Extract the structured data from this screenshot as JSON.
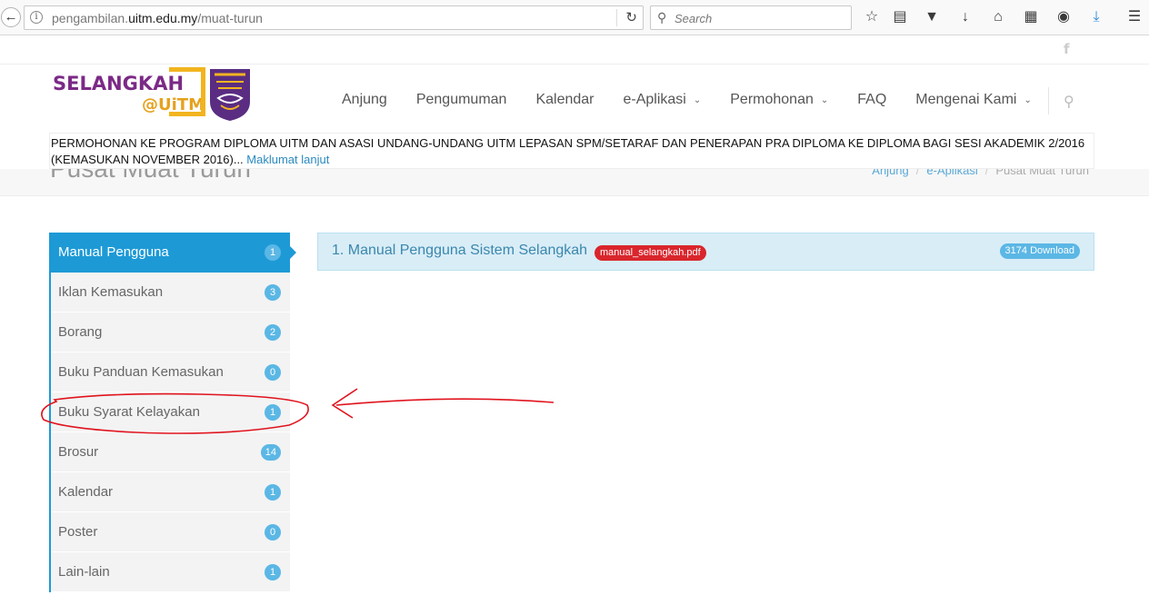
{
  "browser": {
    "url_prefix": "pengambilan.",
    "url_domain": "uitm.edu.my",
    "url_path": "/muat-turun",
    "search_placeholder": "Search"
  },
  "header": {
    "logo_text": "SELANGKAH",
    "logo_suffix": "@UiTM",
    "nav": [
      {
        "label": "Anjung",
        "dropdown": false
      },
      {
        "label": "Pengumuman",
        "dropdown": false
      },
      {
        "label": "Kalendar",
        "dropdown": false
      },
      {
        "label": "e-Aplikasi",
        "dropdown": true
      },
      {
        "label": "Permohonan",
        "dropdown": true
      },
      {
        "label": "FAQ",
        "dropdown": false
      },
      {
        "label": "Mengenai Kami",
        "dropdown": true
      }
    ]
  },
  "announcement": {
    "text": "PERMOHONAN KE PROGRAM DIPLOMA UITM DAN ASASI UNDANG-UNDANG UITM LEPASAN SPM/SETARAF DAN PENERAPAN PRA DIPLOMA KE DIPLOMA BAGI SESI AKADEMIK 2/2016 (KEMASUKAN NOVEMBER 2016)...",
    "link": "Maklumat lanjut"
  },
  "page": {
    "title": "Pusat Muat Turun",
    "breadcrumb": [
      "Anjung",
      "e-Aplikasi",
      "Pusat Muat Turun"
    ]
  },
  "sidebar": {
    "items": [
      {
        "label": "Manual Pengguna",
        "count": "1",
        "active": true
      },
      {
        "label": "Iklan Kemasukan",
        "count": "3",
        "active": false
      },
      {
        "label": "Borang",
        "count": "2",
        "active": false
      },
      {
        "label": "Buku Panduan Kemasukan",
        "count": "0",
        "active": false
      },
      {
        "label": "Buku Syarat Kelayakan",
        "count": "1",
        "active": false
      },
      {
        "label": "Brosur",
        "count": "14",
        "active": false
      },
      {
        "label": "Kalendar",
        "count": "1",
        "active": false
      },
      {
        "label": "Poster",
        "count": "0",
        "active": false
      },
      {
        "label": "Lain-lain",
        "count": "1",
        "active": false
      }
    ]
  },
  "download": {
    "title": "1. Manual Pengguna Sistem Selangkah",
    "file": "manual_selangkah.pdf",
    "count": "3174 Download"
  },
  "colors": {
    "accent": "#1d9ad6",
    "badge": "#5bb7e5",
    "file_badge": "#d9262c",
    "annotation": "#e0141e",
    "brand_purple": "#7b2a86",
    "brand_gold": "#f2b41e"
  },
  "icons": [
    "back-arrow-icon",
    "info-icon",
    "reload-icon",
    "search-icon",
    "bookmark-star-icon",
    "reader-icon",
    "pocket-icon",
    "download-icon",
    "home-icon",
    "extension-icon",
    "color-wheel-icon",
    "download-progress-icon",
    "menu-icon",
    "facebook-icon",
    "search-icon"
  ]
}
